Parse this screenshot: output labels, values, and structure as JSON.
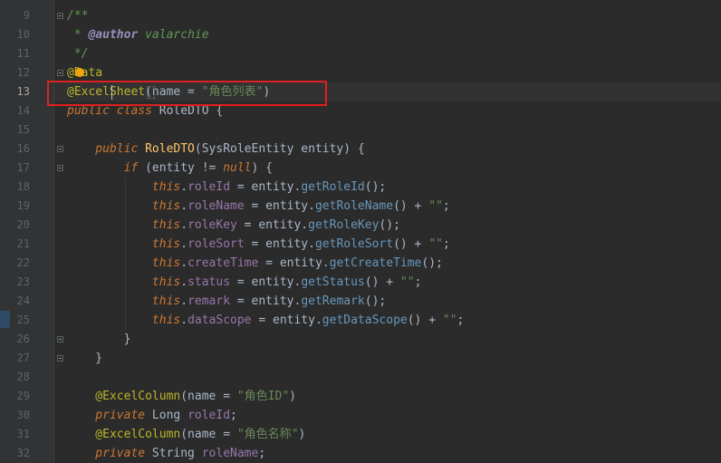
{
  "lines": [
    {
      "n": "9",
      "tokens": [
        {
          "t": "/**",
          "c": "cmt"
        }
      ]
    },
    {
      "n": "10",
      "tokens": [
        {
          "t": " * ",
          "c": "cmt"
        },
        {
          "t": "@author",
          "c": "cmt-tag"
        },
        {
          "t": " valarchie",
          "c": "cmt"
        }
      ]
    },
    {
      "n": "11",
      "tokens": [
        {
          "t": " */",
          "c": "cmt"
        }
      ]
    },
    {
      "n": "12",
      "tokens": [
        {
          "t": "@Data",
          "c": "ann"
        }
      ]
    },
    {
      "n": "13",
      "tokens": [
        {
          "t": "@ExcelSheet",
          "c": "ann"
        },
        {
          "t": "(",
          "c": "ptxt"
        },
        {
          "t": "name = ",
          "c": "ptxt"
        },
        {
          "t": "\"角色列表\"",
          "c": "str"
        },
        {
          "t": ")",
          "c": "ptxt"
        }
      ]
    },
    {
      "n": "14",
      "tokens": [
        {
          "t": "public ",
          "c": "kw"
        },
        {
          "t": "class ",
          "c": "kw"
        },
        {
          "t": "RoleDTO {",
          "c": "ptxt"
        }
      ]
    },
    {
      "n": "15",
      "tokens": []
    },
    {
      "n": "16",
      "tokens": [
        {
          "t": "    public ",
          "c": "kw"
        },
        {
          "t": "RoleDTO",
          "c": "mth"
        },
        {
          "t": "(SysRoleEntity entity) {",
          "c": "ptxt"
        }
      ]
    },
    {
      "n": "17",
      "tokens": [
        {
          "t": "        if ",
          "c": "kw"
        },
        {
          "t": "(entity != ",
          "c": "ptxt"
        },
        {
          "t": "null",
          "c": "kw"
        },
        {
          "t": ") {",
          "c": "ptxt"
        }
      ]
    },
    {
      "n": "18",
      "tokens": [
        {
          "t": "            this",
          "c": "thisk"
        },
        {
          "t": ".",
          "c": "ptxt"
        },
        {
          "t": "roleId",
          "c": "fld"
        },
        {
          "t": " = entity.",
          "c": "ptxt"
        },
        {
          "t": "getRoleId",
          "c": "call"
        },
        {
          "t": "();",
          "c": "ptxt"
        }
      ]
    },
    {
      "n": "19",
      "tokens": [
        {
          "t": "            this",
          "c": "thisk"
        },
        {
          "t": ".",
          "c": "ptxt"
        },
        {
          "t": "roleName",
          "c": "fld"
        },
        {
          "t": " = entity.",
          "c": "ptxt"
        },
        {
          "t": "getRoleName",
          "c": "call"
        },
        {
          "t": "() + ",
          "c": "ptxt"
        },
        {
          "t": "\"\"",
          "c": "str"
        },
        {
          "t": ";",
          "c": "ptxt"
        }
      ]
    },
    {
      "n": "20",
      "tokens": [
        {
          "t": "            this",
          "c": "thisk"
        },
        {
          "t": ".",
          "c": "ptxt"
        },
        {
          "t": "roleKey",
          "c": "fld"
        },
        {
          "t": " = entity.",
          "c": "ptxt"
        },
        {
          "t": "getRoleKey",
          "c": "call"
        },
        {
          "t": "();",
          "c": "ptxt"
        }
      ]
    },
    {
      "n": "21",
      "tokens": [
        {
          "t": "            this",
          "c": "thisk"
        },
        {
          "t": ".",
          "c": "ptxt"
        },
        {
          "t": "roleSort",
          "c": "fld"
        },
        {
          "t": " = entity.",
          "c": "ptxt"
        },
        {
          "t": "getRoleSort",
          "c": "call"
        },
        {
          "t": "() + ",
          "c": "ptxt"
        },
        {
          "t": "\"\"",
          "c": "str"
        },
        {
          "t": ";",
          "c": "ptxt"
        }
      ]
    },
    {
      "n": "22",
      "tokens": [
        {
          "t": "            this",
          "c": "thisk"
        },
        {
          "t": ".",
          "c": "ptxt"
        },
        {
          "t": "createTime",
          "c": "fld"
        },
        {
          "t": " = entity.",
          "c": "ptxt"
        },
        {
          "t": "getCreateTime",
          "c": "call"
        },
        {
          "t": "();",
          "c": "ptxt"
        }
      ]
    },
    {
      "n": "23",
      "tokens": [
        {
          "t": "            this",
          "c": "thisk"
        },
        {
          "t": ".",
          "c": "ptxt"
        },
        {
          "t": "status",
          "c": "fld"
        },
        {
          "t": " = entity.",
          "c": "ptxt"
        },
        {
          "t": "getStatus",
          "c": "call"
        },
        {
          "t": "() + ",
          "c": "ptxt"
        },
        {
          "t": "\"\"",
          "c": "str"
        },
        {
          "t": ";",
          "c": "ptxt"
        }
      ]
    },
    {
      "n": "24",
      "tokens": [
        {
          "t": "            this",
          "c": "thisk"
        },
        {
          "t": ".",
          "c": "ptxt"
        },
        {
          "t": "remark",
          "c": "fld"
        },
        {
          "t": " = entity.",
          "c": "ptxt"
        },
        {
          "t": "getRemark",
          "c": "call"
        },
        {
          "t": "();",
          "c": "ptxt"
        }
      ]
    },
    {
      "n": "25",
      "tokens": [
        {
          "t": "            this",
          "c": "thisk"
        },
        {
          "t": ".",
          "c": "ptxt"
        },
        {
          "t": "dataScope",
          "c": "fld"
        },
        {
          "t": " = entity.",
          "c": "ptxt"
        },
        {
          "t": "getDataScope",
          "c": "call"
        },
        {
          "t": "() + ",
          "c": "ptxt"
        },
        {
          "t": "\"\"",
          "c": "str"
        },
        {
          "t": ";",
          "c": "ptxt"
        }
      ]
    },
    {
      "n": "26",
      "tokens": [
        {
          "t": "        }",
          "c": "ptxt"
        }
      ]
    },
    {
      "n": "27",
      "tokens": [
        {
          "t": "    }",
          "c": "ptxt"
        }
      ]
    },
    {
      "n": "28",
      "tokens": []
    },
    {
      "n": "29",
      "tokens": [
        {
          "t": "    @ExcelColumn",
          "c": "ann"
        },
        {
          "t": "(name = ",
          "c": "ptxt"
        },
        {
          "t": "\"角色ID\"",
          "c": "str"
        },
        {
          "t": ")",
          "c": "ptxt"
        }
      ]
    },
    {
      "n": "30",
      "tokens": [
        {
          "t": "    private ",
          "c": "kw"
        },
        {
          "t": "Long ",
          "c": "ptxt"
        },
        {
          "t": "roleId",
          "c": "fld"
        },
        {
          "t": ";",
          "c": "ptxt"
        }
      ]
    },
    {
      "n": "31",
      "tokens": [
        {
          "t": "    @ExcelColumn",
          "c": "ann"
        },
        {
          "t": "(name = ",
          "c": "ptxt"
        },
        {
          "t": "\"角色名称\"",
          "c": "str"
        },
        {
          "t": ")",
          "c": "ptxt"
        }
      ]
    },
    {
      "n": "32",
      "tokens": [
        {
          "t": "    private ",
          "c": "kw"
        },
        {
          "t": "String ",
          "c": "ptxt"
        },
        {
          "t": "roleName",
          "c": "fld"
        },
        {
          "t": ";",
          "c": "ptxt"
        }
      ]
    }
  ],
  "current_line": "13",
  "fold_lines": [
    "9",
    "12",
    "16",
    "17",
    "26",
    "27"
  ],
  "colors": {
    "background": "#2b2b2b",
    "gutter": "#313335",
    "highlight_box": "#e0201f",
    "annotation": "#bbb529",
    "keyword": "#cc7832",
    "string": "#6a8759",
    "field": "#9876aa"
  },
  "icons": {
    "intention": "lightbulb-icon",
    "fold": "fold-toggle-icon"
  }
}
